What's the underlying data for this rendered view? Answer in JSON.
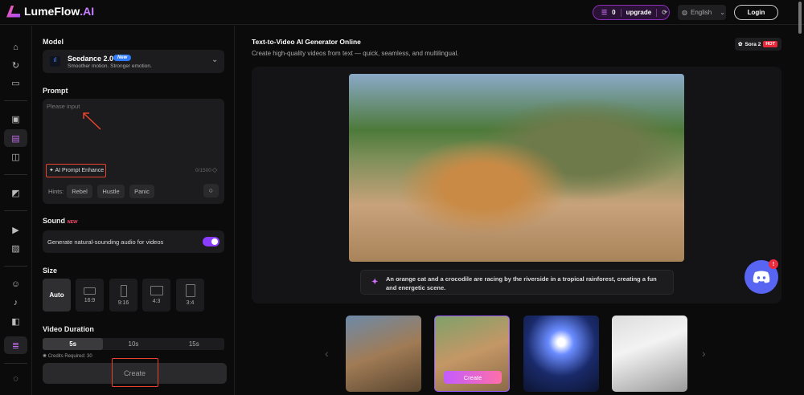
{
  "header": {
    "brand": "LumeFlow",
    "brand_suffix": ".AI",
    "credits": "0",
    "upgrade": "upgrade",
    "language": "English",
    "login": "Login"
  },
  "panel": {
    "model_label": "Model",
    "model_name": "Seedance 2.0",
    "model_badge": "New",
    "model_desc": "Smoother motion. Stronger emotion.",
    "prompt_label": "Prompt",
    "prompt_placeholder": "Please input",
    "enhance": "AI Prompt Enhance",
    "char_count": "0/1500",
    "hints_label": "Hints:",
    "hints": [
      "Rebel",
      "Hustle",
      "Panic"
    ],
    "sound_label": "Sound",
    "sound_badge": "NEW",
    "sound_option": "Generate natural-sounding audio for videos",
    "sound_enabled": true,
    "size_label": "Size",
    "sizes": [
      "Auto",
      "16:9",
      "9:16",
      "4:3",
      "3:4"
    ],
    "size_selected": "Auto",
    "duration_label": "Video Duration",
    "durations": [
      "5s",
      "10s",
      "15s"
    ],
    "duration_selected": "5s",
    "credits_required": "Credits Required:  30",
    "create": "Create"
  },
  "main": {
    "title": "Text-to-Video AI Generator Online",
    "subtitle": "Create high-quality videos from text — quick, seamless, and multilingual.",
    "sora_label": "Sora 2",
    "sora_badge": "HOT",
    "caption": "An orange cat and a crocodile are racing by the riverside in a tropical rainforest, creating a fun and energetic scene.",
    "thumb_create": "Create",
    "selected_thumb": 2,
    "discord_badge": "!"
  },
  "colors": {
    "accent": "#a24bff",
    "annotation": "#e8432e",
    "discord": "#5865f2"
  }
}
